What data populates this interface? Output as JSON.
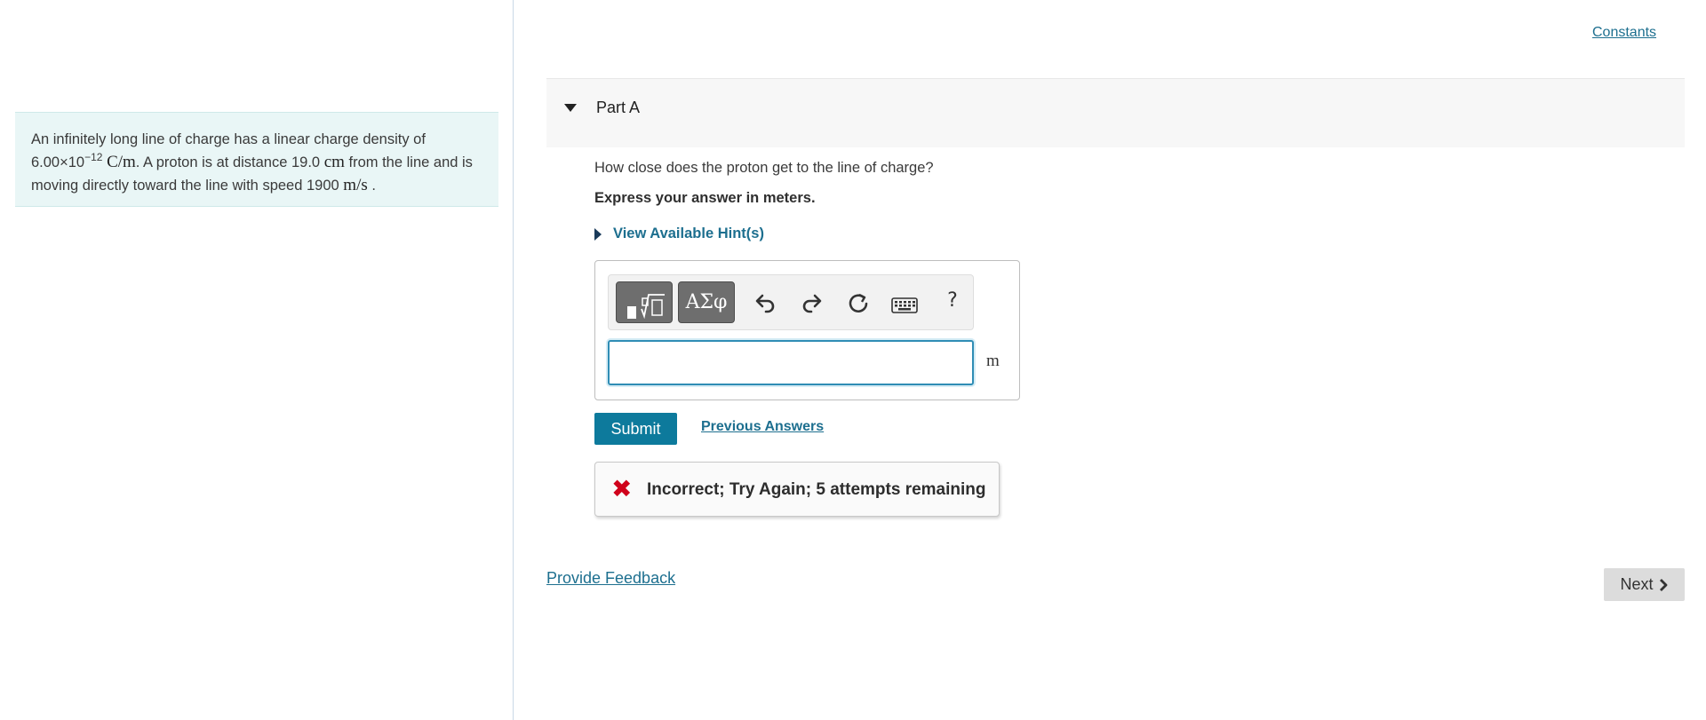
{
  "problem": {
    "text_1": "An infinitely long line of charge has a linear charge density of",
    "density_mantissa": "6.00×10",
    "density_exponent": "−12",
    "density_unit": "C/m",
    "text_2": ". A proton is at distance 19.0",
    "distance_unit": "cm",
    "text_3": "from the line and is moving directly toward the line with speed 1900",
    "speed_unit": "m/s",
    "text_4": "."
  },
  "header": {
    "constants_label": "Constants"
  },
  "part": {
    "title": "Part A",
    "question": "How close does the proton get to the line of charge?",
    "instruction": "Express your answer in meters.",
    "hints_label": "View Available Hint(s)"
  },
  "answer": {
    "value": "",
    "unit": "m",
    "symbols_label": "ΑΣφ",
    "help_label": "?"
  },
  "actions": {
    "submit_label": "Submit",
    "previous_answers_label": "Previous Answers"
  },
  "feedback": {
    "icon": "x-icon",
    "message": "Incorrect; Try Again; 5 attempts remaining",
    "color": "#d0021b"
  },
  "footer": {
    "provide_feedback_label": "Provide Feedback",
    "next_label": "Next"
  },
  "colors": {
    "accent": "#0d7a9c",
    "link": "#1d6f8f",
    "problem_bg": "#e9f6f6"
  }
}
